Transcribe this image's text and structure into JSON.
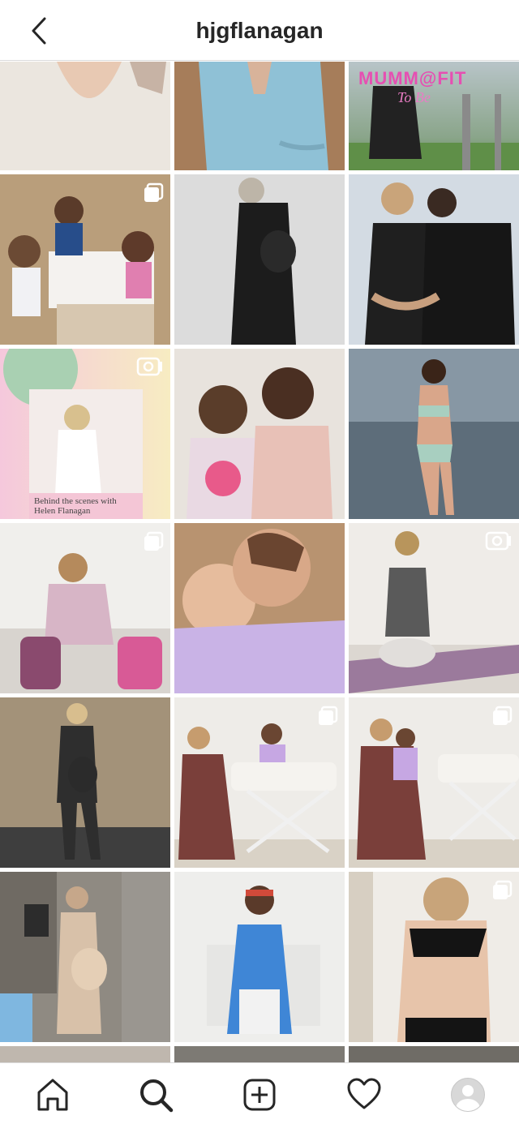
{
  "header": {
    "username": "hjgflanagan",
    "back_icon": "chevron-left-icon"
  },
  "grid": {
    "badges": {
      "multi": "carousel-icon",
      "video": "igtv-icon"
    },
    "posts": [
      {
        "name": "post-ribbed-top",
        "badge": ""
      },
      {
        "name": "post-blue-blazer",
        "badge": ""
      },
      {
        "name": "post-mumm-fit",
        "badge": "",
        "overlay": "MUMM@FIT",
        "overlay_sub": "To Be"
      },
      {
        "name": "post-kids-bathroom",
        "badge": "multi"
      },
      {
        "name": "post-black-dress-bw",
        "badge": ""
      },
      {
        "name": "post-couple-kiss",
        "badge": ""
      },
      {
        "name": "post-behind-the-scenes",
        "badge": "video",
        "caption": "Behind the scenes with Helen Flanagan"
      },
      {
        "name": "post-girls-toys",
        "badge": ""
      },
      {
        "name": "post-beach-bikini",
        "badge": ""
      },
      {
        "name": "post-girls-backpacks",
        "badge": "multi"
      },
      {
        "name": "post-hug-selfie",
        "badge": ""
      },
      {
        "name": "post-yoga-mat",
        "badge": "video"
      },
      {
        "name": "post-wall-outdoor",
        "badge": ""
      },
      {
        "name": "post-moses-basket-1",
        "badge": "multi"
      },
      {
        "name": "post-moses-basket-2",
        "badge": "multi"
      },
      {
        "name": "post-kitchen-cardigan",
        "badge": ""
      },
      {
        "name": "post-girl-blue-dress",
        "badge": ""
      },
      {
        "name": "post-lace-bra",
        "badge": "multi"
      },
      {
        "name": "post-partial-1",
        "badge": ""
      },
      {
        "name": "post-partial-2",
        "badge": ""
      },
      {
        "name": "post-partial-3",
        "badge": ""
      }
    ]
  },
  "nav": {
    "home_icon": "home-icon",
    "search_icon": "search-icon",
    "new_post_icon": "new-post-icon",
    "activity_icon": "heart-icon",
    "profile_icon": "profile-avatar"
  }
}
